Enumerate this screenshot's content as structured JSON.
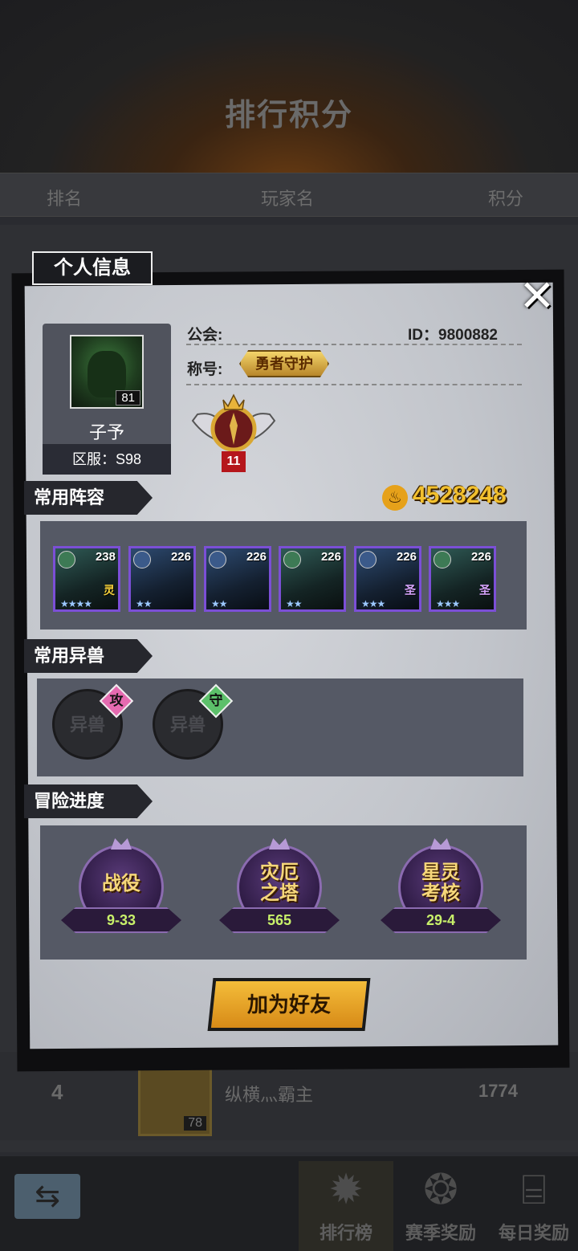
{
  "background": {
    "title": "排行积分",
    "headers": {
      "rank": "排名",
      "player": "玩家名",
      "score": "积分"
    },
    "visible_row": {
      "rank": "4",
      "level": "78",
      "name": "纵横灬霸主",
      "score": "1774"
    },
    "nav": [
      {
        "label": "排行榜",
        "icon": "sun-icon",
        "glyph": "✹"
      },
      {
        "label": "赛季奖励",
        "icon": "emblem-icon",
        "glyph": "❂"
      },
      {
        "label": "每日奖励",
        "icon": "gift-icon",
        "glyph": "⌸"
      }
    ],
    "back_glyph": "⇆"
  },
  "panel": {
    "tab_title": "个人信息",
    "close_glyph": "✕",
    "player": {
      "name": "子予",
      "level": "81",
      "server": "区服：S98",
      "guild_label": "公会:",
      "id": "ID：9800882",
      "title_label": "称号:",
      "title_badge": "勇者守护",
      "rank_level": "11"
    },
    "lineup": {
      "section": "常用阵容",
      "power": "4528248",
      "heroes": [
        {
          "level": "238",
          "stars": "★★★★",
          "cls": "灵",
          "theme": "green"
        },
        {
          "level": "226",
          "stars": "★★",
          "cls": "",
          "theme": "blue"
        },
        {
          "level": "226",
          "stars": "★★",
          "cls": "",
          "theme": "blue"
        },
        {
          "level": "226",
          "stars": "★★",
          "cls": "",
          "theme": "green"
        },
        {
          "level": "226",
          "stars": "★★★",
          "cls": "圣",
          "theme": "blue"
        },
        {
          "level": "226",
          "stars": "★★★",
          "cls": "圣",
          "theme": "green"
        }
      ]
    },
    "beasts": {
      "section": "常用异兽",
      "slots": [
        {
          "label": "异兽",
          "badge": "攻",
          "badge_color": "#e56ab0"
        },
        {
          "label": "异兽",
          "badge": "守",
          "badge_color": "#5cc06a"
        }
      ]
    },
    "adventure": {
      "section": "冒险进度",
      "items": [
        {
          "name": "战役",
          "value": "9-33"
        },
        {
          "name": "灾厄之塔",
          "value": "565"
        },
        {
          "name": "星灵考核",
          "value": "29-4"
        }
      ]
    },
    "add_friend": "加为好友"
  }
}
